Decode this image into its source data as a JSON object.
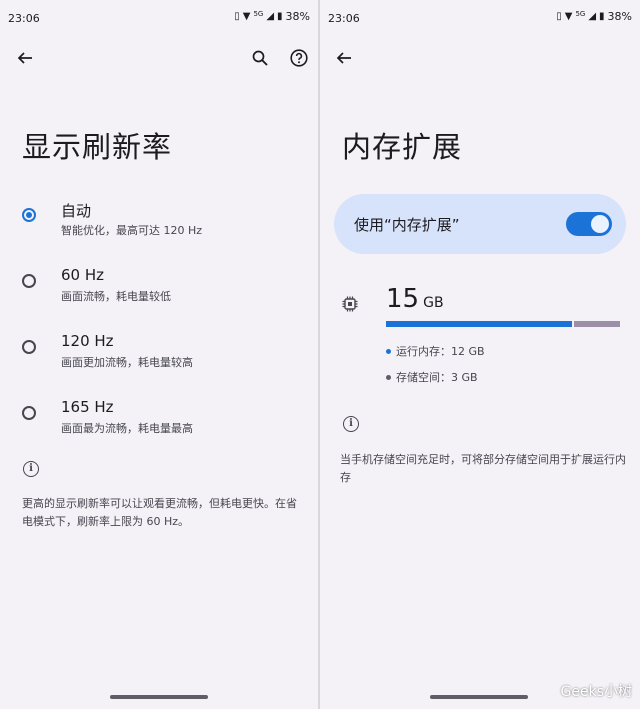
{
  "colors": {
    "accent": "#1b73d8",
    "storage_bar": "#9b90a8",
    "card_bg": "#d7e3fb"
  },
  "left": {
    "status": {
      "time": "23:06",
      "network": "5G",
      "battery": "38%"
    },
    "title": "显示刷新率",
    "options": [
      {
        "label": "自动",
        "sub": "智能优化，最高可达 120 Hz",
        "checked": true
      },
      {
        "label": "60 Hz",
        "sub": "画面流畅，耗电量较低",
        "checked": false
      },
      {
        "label": "120 Hz",
        "sub": "画面更加流畅，耗电量较高",
        "checked": false
      },
      {
        "label": "165 Hz",
        "sub": "画面最为流畅，耗电量最高",
        "checked": false
      }
    ],
    "note": "更高的显示刷新率可以让观看更流畅，但耗电更快。在省电模式下，刷新率上限为 60 Hz。"
  },
  "right": {
    "status": {
      "time": "23:06",
      "network": "5G",
      "battery": "38%"
    },
    "title": "内存扩展",
    "toggle": {
      "label": "使用“内存扩展”",
      "on": true
    },
    "memory": {
      "total": "15",
      "unit": "GB",
      "ram_fraction": 0.8,
      "ram_label": "运行内存：12 GB",
      "storage_label": "存储空间：3 GB"
    },
    "note": "当手机存储空间充足时，可将部分存储空间用于扩展运行内存"
  },
  "watermark": "Geeks小树"
}
